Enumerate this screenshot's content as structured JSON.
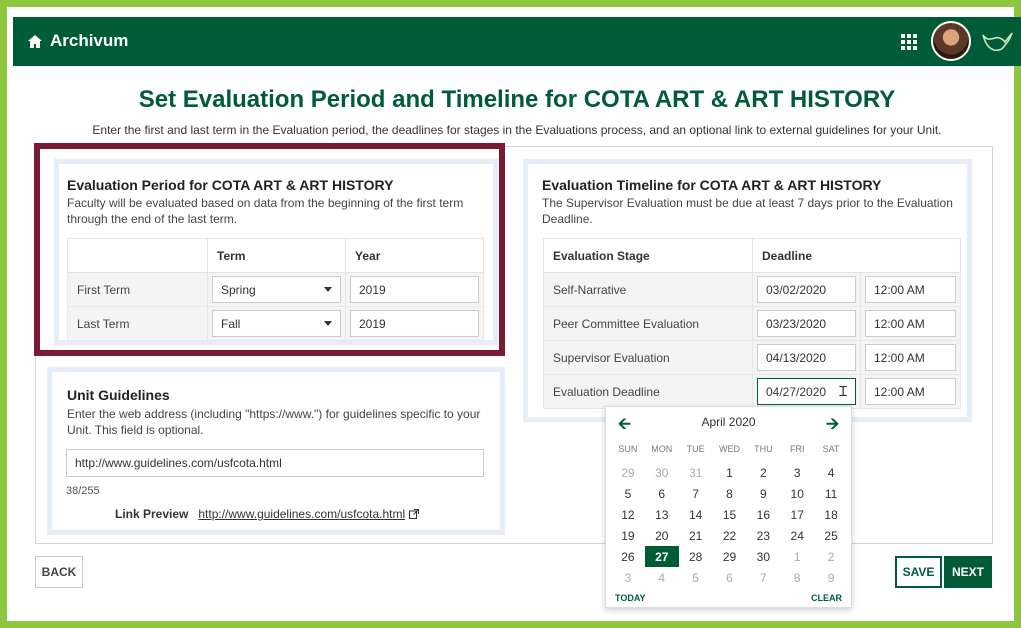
{
  "app": {
    "name": "Archivum"
  },
  "page": {
    "title": "Set Evaluation Period and Timeline for COTA ART & ART HISTORY",
    "subtitle": "Enter the first and last term in the Evaluation period, the deadlines for stages in the Evaluations process, and an optional link to external guidelines for your Unit."
  },
  "period": {
    "heading": "Evaluation Period for COTA ART & ART HISTORY",
    "desc": "Faculty will be evaluated based on data from the beginning of the first term through the end of the last term.",
    "col_term": "Term",
    "col_year": "Year",
    "rows": [
      {
        "label": "First Term",
        "term": "Spring",
        "year": "2019"
      },
      {
        "label": "Last Term",
        "term": "Fall",
        "year": "2019"
      }
    ]
  },
  "timeline": {
    "heading": "Evaluation Timeline for COTA ART & ART HISTORY",
    "desc": "The Supervisor Evaluation must be due at least 7 days prior to the Evaluation Deadline.",
    "col_stage": "Evaluation Stage",
    "col_deadline": "Deadline",
    "rows": [
      {
        "stage": "Self-Narrative",
        "date": "03/02/2020",
        "time": "12:00 AM"
      },
      {
        "stage": "Peer Committee Evaluation",
        "date": "03/23/2020",
        "time": "12:00 AM"
      },
      {
        "stage": "Supervisor Evaluation",
        "date": "04/13/2020",
        "time": "12:00 AM"
      },
      {
        "stage": "Evaluation Deadline",
        "date": "04/27/2020",
        "time": "12:00 AM"
      }
    ]
  },
  "guidelines": {
    "heading": "Unit Guidelines",
    "desc": "Enter the web address (including \"https://www.\") for guidelines specific to your Unit. This field is optional.",
    "url": "http://www.guidelines.com/usfcota.html",
    "counter": "38/255",
    "preview_label": "Link Preview",
    "preview_link": "http://www.guidelines.com/usfcota.html"
  },
  "calendar": {
    "month": "April 2020",
    "dow": [
      "SUN",
      "MON",
      "TUE",
      "WED",
      "THU",
      "FRI",
      "SAT"
    ],
    "today_label": "TODAY",
    "clear_label": "CLEAR"
  },
  "buttons": {
    "back": "BACK",
    "save": "SAVE",
    "next": "NEXT"
  },
  "colors": {
    "brand_green": "#005c36",
    "frame_green": "#8dc63f",
    "highlight": "#7a1a33"
  }
}
